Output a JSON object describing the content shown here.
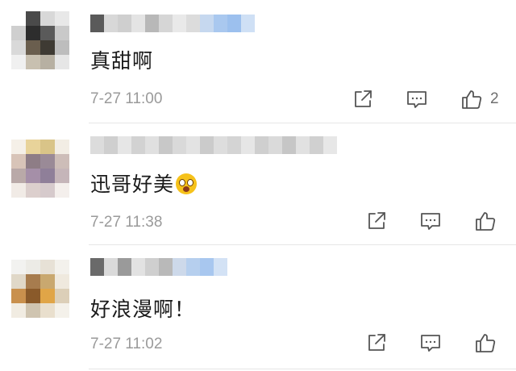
{
  "comments": [
    {
      "content": "真甜啊",
      "time": "7-27 11:00",
      "like_count": "2",
      "avatar_colors": [
        "#ffffff",
        "#4a4a4a",
        "#d8d8d8",
        "#e8e8e8",
        "#cfcfcf",
        "#2d2d2d",
        "#5a5a5a",
        "#c9c9c9",
        "#d9d9d9",
        "#6a5e4e",
        "#3e3a33",
        "#bdbdbd",
        "#f0f0f0",
        "#c8c0b0",
        "#b7b0a2",
        "#e6e6e6"
      ],
      "username_colors": [
        "#5a5a5a",
        "#d8d8d8",
        "#cfcfcf",
        "#e4e4e4",
        "#b8b8b8",
        "#d6d6d6",
        "#e9e9e9",
        "#dcdcdc",
        "#c6d8ef",
        "#a9c8ef",
        "#9cc0ee",
        "#cfe0f5"
      ]
    },
    {
      "content": "迅哥好美",
      "time": "7-27 11:38",
      "like_count": "",
      "avatar_colors": [
        "#f5f0e8",
        "#e8d39a",
        "#d9c488",
        "#f2ede4",
        "#d8c4b8",
        "#8e7d86",
        "#9a8a97",
        "#cdbdb8",
        "#b9a9a8",
        "#a58fa8",
        "#8f7f99",
        "#c5b5b9",
        "#f1ebe6",
        "#dccfcd",
        "#d6cacc",
        "#f4efec"
      ],
      "username_colors": [
        "#dcdcdc",
        "#cfcfcf",
        "#e6e6e6",
        "#d2d2d2",
        "#e0e0e0",
        "#c8c8c8",
        "#d9d9d9",
        "#e3e3e3",
        "#cbcbcb",
        "#dddddd",
        "#d4d4d4",
        "#e6e6e6",
        "#cfcfcf",
        "#dadada",
        "#c6c6c6",
        "#e1e1e1",
        "#d0d0d0",
        "#e7e7e7"
      ]
    },
    {
      "content": "好浪漫啊！",
      "time": "7-27 11:02",
      "like_count": "",
      "avatar_colors": [
        "#f2f2f0",
        "#ecebe6",
        "#e7e1d6",
        "#f3f1ec",
        "#e0d8c8",
        "#a77c4e",
        "#c9a86f",
        "#efe9de",
        "#c9904d",
        "#8a5a2a",
        "#e0a547",
        "#dccfb8",
        "#f1ece2",
        "#cfc4b0",
        "#e9dfcd",
        "#f4f1ea"
      ],
      "username_colors": [
        "#6a6a6a",
        "#dadada",
        "#9a9a9a",
        "#e2e2e2",
        "#cfcfcf",
        "#b9b9b9",
        "#cdd9ea",
        "#b6cfee",
        "#a8c7ef",
        "#d3e2f5"
      ]
    }
  ],
  "icons": {
    "share": "share-icon",
    "reply": "comment-reply-icon",
    "like": "thumbs-up-icon"
  },
  "colors": {
    "text": "#1a1a1a",
    "meta": "#9a9a9a",
    "icon": "#555555",
    "divider": "#e6e6e6"
  }
}
